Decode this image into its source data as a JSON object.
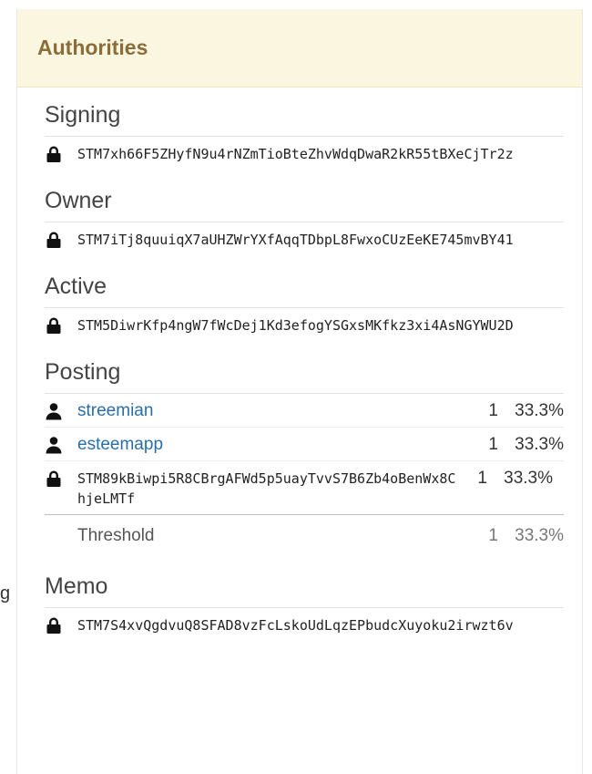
{
  "stray_text": "g",
  "panel": {
    "title": "Authorities"
  },
  "sections": {
    "signing": {
      "title": "Signing",
      "key": "STM7xh66F5ZHyfN9u4rNZmTioBteZhvWdqDwaR2kR55tBXeCjTr2z",
      "icon": "lock-icon"
    },
    "owner": {
      "title": "Owner",
      "key": "STM7iTj8quuiqX7aUHZWrYXfAqqTDbpL8FwxoCUzEeKE745mvBY41",
      "icon": "lock-icon"
    },
    "active": {
      "title": "Active",
      "key": "STM5DiwrKfp4ngW7fWcDej1Kd3efogYSGxsMKfkz3xi4AsNGYWU2D",
      "icon": "lock-icon"
    },
    "posting": {
      "title": "Posting",
      "entries": [
        {
          "type": "account",
          "icon": "user-icon",
          "name": "streemian",
          "weight": "1",
          "pct": "33.3%"
        },
        {
          "type": "account",
          "icon": "user-icon",
          "name": "esteemapp",
          "weight": "1",
          "pct": "33.3%"
        },
        {
          "type": "key",
          "icon": "lock-icon",
          "name": "STM89kBiwpi5R8CBrgAFWd5p5uayTvvS7B6Zb4oBenWx8ChjeLMTf",
          "weight": "1",
          "pct": "33.3%"
        }
      ],
      "threshold": {
        "label": "Threshold",
        "weight": "1",
        "pct": "33.3%"
      }
    },
    "memo": {
      "title": "Memo",
      "key": "STM7S4xvQgdvuQ8SFAD8vzFcLskoUdLqzEPbudcXuyoku2irwzt6v",
      "icon": "lock-icon"
    }
  },
  "colors": {
    "header_bg": "#fbf6df",
    "title": "#8a6d3b",
    "link": "#2a6ea8"
  }
}
